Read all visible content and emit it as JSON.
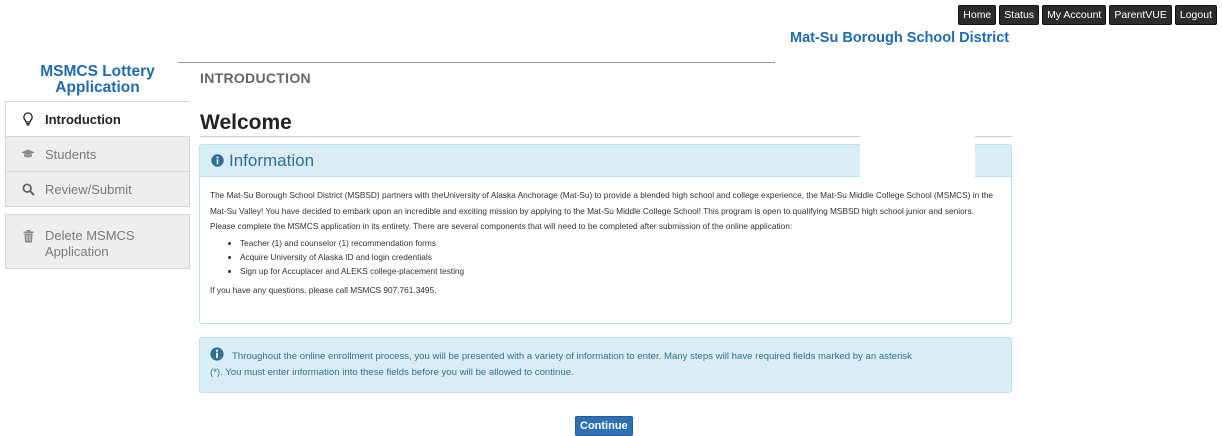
{
  "topnav": {
    "home": "Home",
    "status": "Status",
    "account": "My Account",
    "parentvue": "ParentVUE",
    "logout": "Logout"
  },
  "header": {
    "district": "Mat-Su Borough School District"
  },
  "sidebar": {
    "title": "MSMCS Lottery Application",
    "items": [
      {
        "label": "Introduction",
        "icon": "lightbulb-icon"
      },
      {
        "label": "Students",
        "icon": "graduation-cap-icon"
      },
      {
        "label": "Review/Submit",
        "icon": "search-icon"
      }
    ],
    "delete_label": "Delete MSMCS Application"
  },
  "main": {
    "section_heading": "INTRODUCTION",
    "welcome": "Welcome",
    "info_title": "Information",
    "info_paragraph": "The Mat-Su Borough School District (MSBSD) partners with theUniversity of Alaska Anchorage (Mat-Su) to provide a blended high school and college experience, the Mat-Su Middle College School (MSMCS) in the Mat-Su Valley! You have decided to embark upon an incredible and exciting mission by applying to the Mat-Su Middle College School! This program is open to qualifying MSBSD high school junior and seniors. Please complete the MSMCS application in its entirety. There are several components that will need to be completed after submission of the online application:",
    "info_list": [
      "Teacher (1)  and counselor (1) recommendation forms",
      "Acquire University of Alaska ID and login credentials",
      "Sign up for Accuplacer and ALEKS college-placement testing"
    ],
    "questions": "If you have any questions, please call MSMCS 907.761.3495.",
    "alert_line1": "Throughout the online enrollment process, you will be presented with a variety of information to enter. Many steps will have required fields marked by an asterisk",
    "alert_line2": "(*). You must enter information into these fields before you will be allowed to continue.",
    "continue": "Continue"
  },
  "colors": {
    "brand": "#1f6bb0",
    "info_bg": "#d9edf7",
    "info_text": "#31708f",
    "button": "#2e6fb5"
  }
}
